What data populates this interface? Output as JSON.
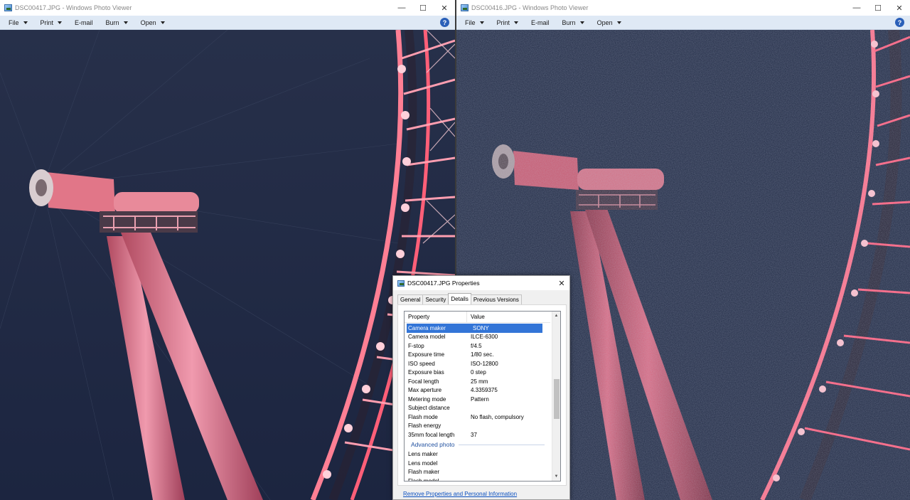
{
  "windows": [
    {
      "id": "left",
      "title": "DSC00417.JPG - Windows Photo Viewer",
      "menu": [
        {
          "label": "File",
          "has_dropdown": true
        },
        {
          "label": "Print",
          "has_dropdown": true
        },
        {
          "label": "E-mail",
          "has_dropdown": false
        },
        {
          "label": "Burn",
          "has_dropdown": true
        },
        {
          "label": "Open",
          "has_dropdown": true
        }
      ]
    },
    {
      "id": "right",
      "title": "DSC00416.JPG - Windows Photo Viewer",
      "menu": [
        {
          "label": "File",
          "has_dropdown": true
        },
        {
          "label": "Print",
          "has_dropdown": true
        },
        {
          "label": "E-mail",
          "has_dropdown": false
        },
        {
          "label": "Burn",
          "has_dropdown": true
        },
        {
          "label": "Open",
          "has_dropdown": true
        }
      ]
    }
  ],
  "window_controls": {
    "minimize": "—",
    "maximize": "☐",
    "close": "✕"
  },
  "help_icon": "?",
  "dialog": {
    "title": "DSC00417.JPG Properties",
    "close": "✕",
    "tabs": [
      "General",
      "Security",
      "Details",
      "Previous Versions"
    ],
    "active_tab": "Details",
    "columns": {
      "property": "Property",
      "value": "Value"
    },
    "rows": [
      {
        "property": "Camera maker",
        "value": "SONY",
        "selected": true
      },
      {
        "property": "Camera model",
        "value": "ILCE-6300"
      },
      {
        "property": "F-stop",
        "value": "f/4.5"
      },
      {
        "property": "Exposure time",
        "value": "1/80 sec."
      },
      {
        "property": "ISO speed",
        "value": "ISO-12800"
      },
      {
        "property": "Exposure bias",
        "value": "0 step"
      },
      {
        "property": "Focal length",
        "value": "25 mm"
      },
      {
        "property": "Max aperture",
        "value": "4.3359375"
      },
      {
        "property": "Metering mode",
        "value": "Pattern"
      },
      {
        "property": "Subject distance",
        "value": ""
      },
      {
        "property": "Flash mode",
        "value": "No flash, compulsory"
      },
      {
        "property": "Flash energy",
        "value": ""
      },
      {
        "property": "35mm focal length",
        "value": "37"
      }
    ],
    "section": "Advanced photo",
    "section_rows": [
      {
        "property": "Lens maker",
        "value": ""
      },
      {
        "property": "Lens model",
        "value": ""
      },
      {
        "property": "Flash maker",
        "value": ""
      },
      {
        "property": "Flash model",
        "value": ""
      }
    ],
    "remove_link": "Remove Properties and Personal Information"
  },
  "colors": {
    "sky": "#1e2740",
    "ride_pink": "#d86878",
    "ride_light": "#ffb6c8",
    "selection": "#3375d7",
    "link": "#0a4fbf"
  }
}
